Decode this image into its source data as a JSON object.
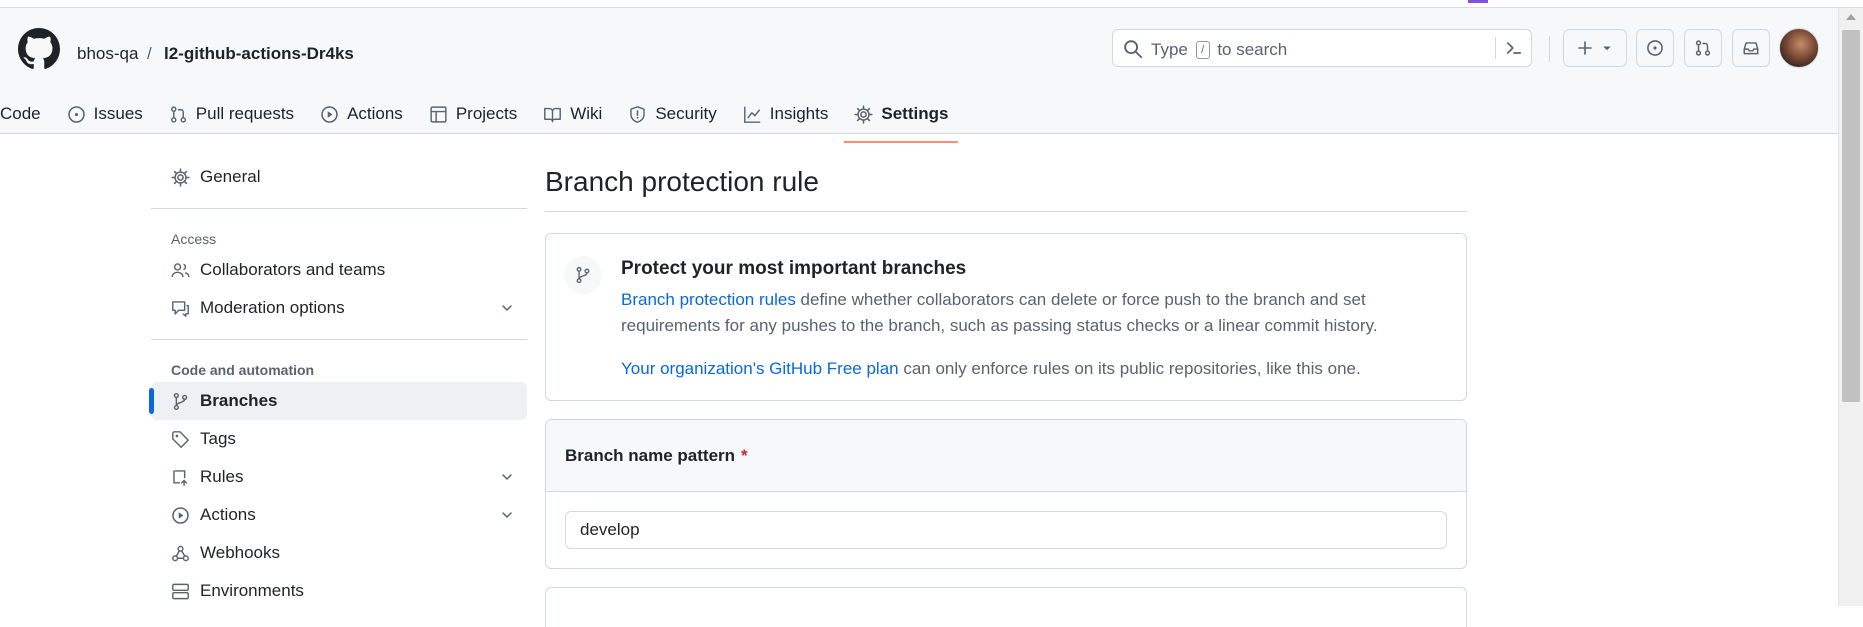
{
  "header": {
    "owner": "bhos-qa",
    "separator": "/",
    "repo": "l2-github-actions-Dr4ks",
    "search": {
      "prefix": "Type",
      "key": "/",
      "suffix": "to search"
    }
  },
  "tabs": [
    {
      "label": "Code",
      "icon": "code-icon"
    },
    {
      "label": "Issues",
      "icon": "issue-icon"
    },
    {
      "label": "Pull requests",
      "icon": "pull-request-icon"
    },
    {
      "label": "Actions",
      "icon": "play-icon"
    },
    {
      "label": "Projects",
      "icon": "table-icon"
    },
    {
      "label": "Wiki",
      "icon": "book-icon"
    },
    {
      "label": "Security",
      "icon": "shield-icon"
    },
    {
      "label": "Insights",
      "icon": "graph-icon"
    },
    {
      "label": "Settings",
      "icon": "gear-icon",
      "active": true
    }
  ],
  "sidebar": {
    "general": "General",
    "access_heading": "Access",
    "collaborators": "Collaborators and teams",
    "moderation": "Moderation options",
    "code_heading": "Code and automation",
    "branches": "Branches",
    "tags": "Tags",
    "rules": "Rules",
    "actions": "Actions",
    "webhooks": "Webhooks",
    "environments": "Environments"
  },
  "main": {
    "title": "Branch protection rule",
    "info": {
      "title": "Protect your most important branches",
      "link1": "Branch protection rules",
      "text1": " define whether collaborators can delete or force push to the branch and set requirements for any pushes to the branch, such as passing status checks or a linear commit history.",
      "link2": "Your organization's GitHub Free plan",
      "text2": " can only enforce rules on its public repositories, like this one."
    },
    "pattern": {
      "label": "Branch name pattern",
      "required_mark": "*",
      "value": "develop"
    }
  },
  "colors": {
    "accent": "#0969da",
    "active_underline": "#fd8c73",
    "required": "#d1242f"
  }
}
